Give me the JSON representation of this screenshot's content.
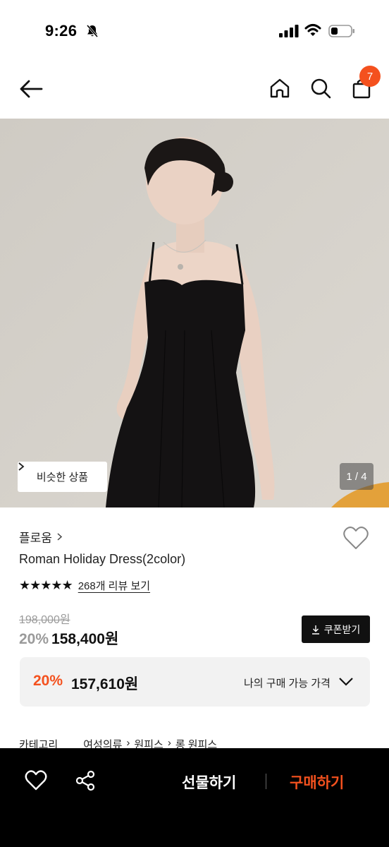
{
  "status_bar": {
    "time": "9:26"
  },
  "header": {
    "cart_count": "7",
    "icons": [
      "back-arrow-icon",
      "home-icon",
      "search-icon",
      "shopping-bag-icon"
    ]
  },
  "gallery": {
    "similar_label": "비슷한 상품",
    "counter": "1 / 4"
  },
  "product": {
    "brand": "플로움",
    "name": "Roman Holiday Dress(2color)",
    "stars": "★★★★★",
    "review_link": "268개 리뷰 보기",
    "original_price": "198,000원",
    "discount": "20%",
    "sale_price": "158,400원",
    "coupon_label": "쿠폰받기"
  },
  "my_price": {
    "discount": "20%",
    "price": "157,610원",
    "label": "나의 구매 가능 가격"
  },
  "category": {
    "label": "카테고리",
    "path": [
      "여성의류",
      "원피스",
      "롱 원피스"
    ]
  },
  "bottom_bar": {
    "gift_label": "선물하기",
    "buy_label": "구매하기"
  },
  "colors": {
    "accent": "#f4511e",
    "dark": "#111111",
    "bottom_bar": "#000000"
  }
}
